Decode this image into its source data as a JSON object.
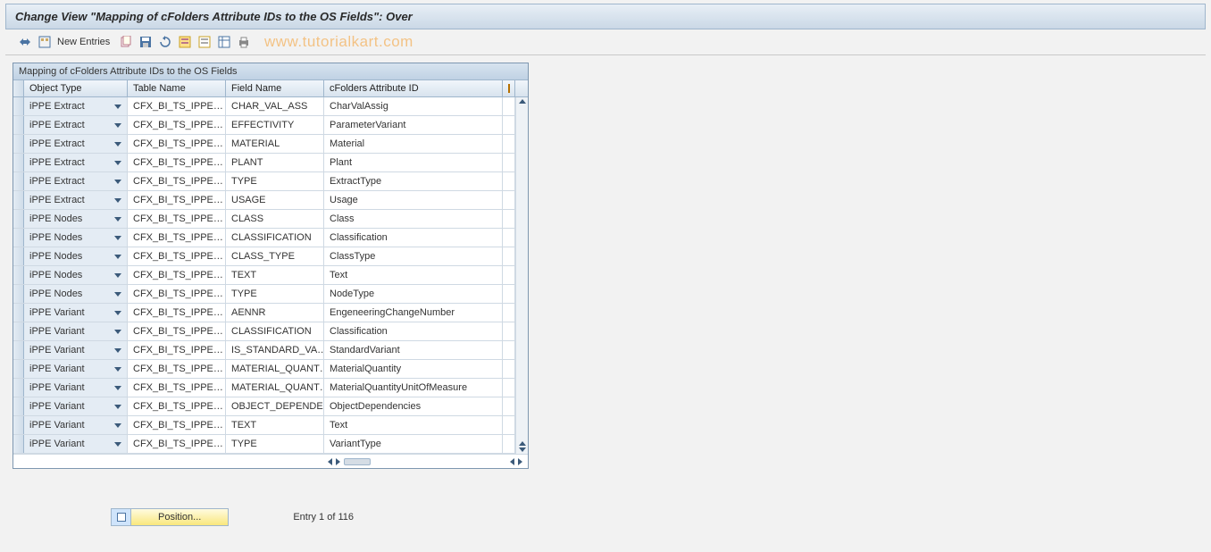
{
  "title": "Change View \"Mapping of cFolders Attribute IDs to the OS Fields\": Over",
  "toolbar": {
    "new_entries_label": "New Entries"
  },
  "watermark": "www.tutorialkart.com",
  "grid": {
    "caption": "Mapping of cFolders Attribute IDs to the OS Fields",
    "columns": {
      "object_type": "Object Type",
      "table_name": "Table Name",
      "field_name": "Field Name",
      "attr_id": "cFolders Attribute ID"
    },
    "rows": [
      {
        "object_type": "iPPE Extract",
        "table_name": "CFX_BI_TS_IPPE…",
        "field_name": "CHAR_VAL_ASS",
        "attr_id": "CharValAssig"
      },
      {
        "object_type": "iPPE Extract",
        "table_name": "CFX_BI_TS_IPPE…",
        "field_name": "EFFECTIVITY",
        "attr_id": "ParameterVariant"
      },
      {
        "object_type": "iPPE Extract",
        "table_name": "CFX_BI_TS_IPPE…",
        "field_name": "MATERIAL",
        "attr_id": "Material"
      },
      {
        "object_type": "iPPE Extract",
        "table_name": "CFX_BI_TS_IPPE…",
        "field_name": "PLANT",
        "attr_id": "Plant"
      },
      {
        "object_type": "iPPE Extract",
        "table_name": "CFX_BI_TS_IPPE…",
        "field_name": "TYPE",
        "attr_id": "ExtractType"
      },
      {
        "object_type": "iPPE Extract",
        "table_name": "CFX_BI_TS_IPPE…",
        "field_name": "USAGE",
        "attr_id": "Usage"
      },
      {
        "object_type": "iPPE Nodes",
        "table_name": "CFX_BI_TS_IPPE…",
        "field_name": "CLASS",
        "attr_id": "Class"
      },
      {
        "object_type": "iPPE Nodes",
        "table_name": "CFX_BI_TS_IPPE…",
        "field_name": "CLASSIFICATION",
        "attr_id": "Classification"
      },
      {
        "object_type": "iPPE Nodes",
        "table_name": "CFX_BI_TS_IPPE…",
        "field_name": "CLASS_TYPE",
        "attr_id": "ClassType"
      },
      {
        "object_type": "iPPE Nodes",
        "table_name": "CFX_BI_TS_IPPE…",
        "field_name": "TEXT",
        "attr_id": "Text"
      },
      {
        "object_type": "iPPE Nodes",
        "table_name": "CFX_BI_TS_IPPE…",
        "field_name": "TYPE",
        "attr_id": "NodeType"
      },
      {
        "object_type": "iPPE Variant",
        "table_name": "CFX_BI_TS_IPPE…",
        "field_name": "AENNR",
        "attr_id": "EngeneeringChangeNumber"
      },
      {
        "object_type": "iPPE Variant",
        "table_name": "CFX_BI_TS_IPPE…",
        "field_name": "CLASSIFICATION",
        "attr_id": "Classification"
      },
      {
        "object_type": "iPPE Variant",
        "table_name": "CFX_BI_TS_IPPE…",
        "field_name": "IS_STANDARD_VA…",
        "attr_id": "StandardVariant"
      },
      {
        "object_type": "iPPE Variant",
        "table_name": "CFX_BI_TS_IPPE…",
        "field_name": "MATERIAL_QUANT…",
        "attr_id": "MaterialQuantity"
      },
      {
        "object_type": "iPPE Variant",
        "table_name": "CFX_BI_TS_IPPE…",
        "field_name": "MATERIAL_QUANT…",
        "attr_id": "MaterialQuantityUnitOfMeasure"
      },
      {
        "object_type": "iPPE Variant",
        "table_name": "CFX_BI_TS_IPPE…",
        "field_name": "OBJECT_DEPENDE…",
        "attr_id": "ObjectDependencies"
      },
      {
        "object_type": "iPPE Variant",
        "table_name": "CFX_BI_TS_IPPE…",
        "field_name": "TEXT",
        "attr_id": "Text"
      },
      {
        "object_type": "iPPE Variant",
        "table_name": "CFX_BI_TS_IPPE…",
        "field_name": "TYPE",
        "attr_id": "VariantType"
      }
    ]
  },
  "position_label": "Position...",
  "entry_status": "Entry 1 of 116"
}
